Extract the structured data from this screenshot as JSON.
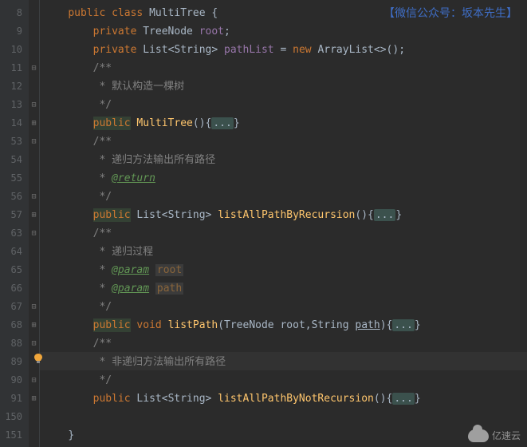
{
  "watermark_top": "【微信公众号：坂本先生】",
  "watermark_logo_text": "亿速云",
  "gutter_lines": [
    "8",
    "9",
    "10",
    "11",
    "12",
    "13",
    "14",
    "53",
    "54",
    "55",
    "56",
    "57",
    "63",
    "64",
    "65",
    "66",
    "67",
    "68",
    "88",
    "89",
    "90",
    "91",
    "150",
    "151"
  ],
  "fold_icons": [
    "",
    "",
    "",
    "⊟",
    "",
    "⊟",
    "⊞",
    "⊟",
    "",
    "",
    "⊟",
    "⊞",
    "⊟",
    "",
    "",
    "",
    "⊟",
    "⊞",
    "⊟",
    "",
    "⊟",
    "⊞",
    "",
    ""
  ],
  "tokens": {
    "kw_public": "public",
    "kw_class": "class",
    "kw_private": "private",
    "kw_new": "new",
    "kw_void": "void",
    "cls_MultiTree": "MultiTree",
    "cls_TreeNode": "TreeNode",
    "cls_List": "List",
    "cls_String": "String",
    "cls_ArrayList": "ArrayList",
    "fld_root": "root",
    "fld_pathList": "pathList",
    "m_MultiTree": "MultiTree",
    "m_listAllPathByRecursion": "listAllPathByRecursion",
    "m_listPath": "listPath",
    "m_listAllPathByNotRecursion": "listAllPathByNotRecursion",
    "p_root": "root",
    "p_path": "path",
    "doc_open": "/**",
    "doc_close": " */",
    "doc_star": " * ",
    "doc_c1": "默认构造一棵树",
    "doc_c2": "递归方法输出所有路径",
    "doc_c3": "递归过程",
    "doc_c4": "非递归方法输出所有路径",
    "tag_return": "@return",
    "tag_param": "@param",
    "folded": "...",
    "brace_open": "{",
    "brace_close": "}",
    "paren": "()",
    "paren_open": "(",
    "paren_close": ")",
    "lt": "<",
    "gt": ">",
    "eq": " = ",
    "semi": ";",
    "comma": ","
  }
}
